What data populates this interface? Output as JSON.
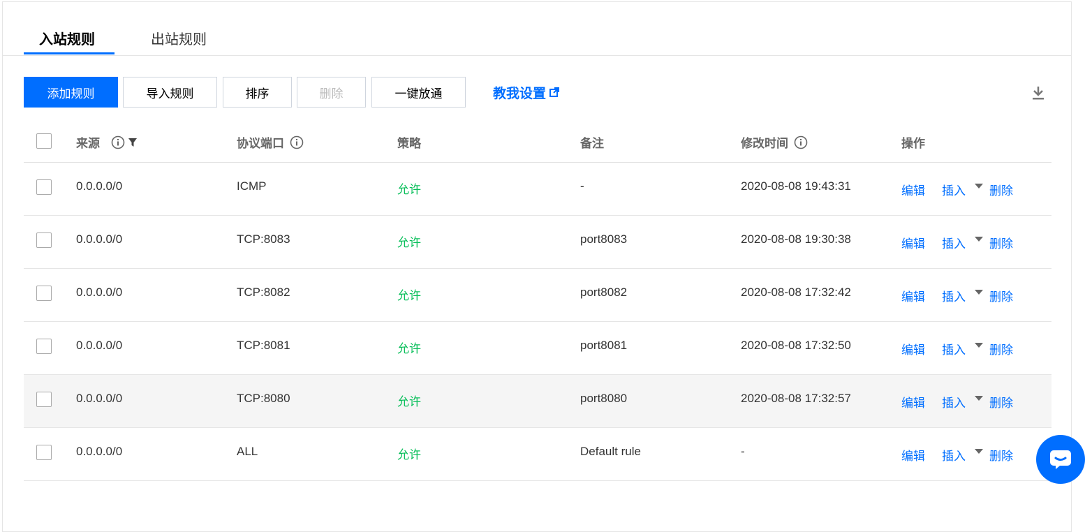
{
  "tabs": [
    {
      "label": "入站规则",
      "active": true
    },
    {
      "label": "出站规则",
      "active": false
    }
  ],
  "toolbar": {
    "add_label": "添加规则",
    "import_label": "导入规则",
    "sort_label": "排序",
    "delete_label": "删除",
    "open_all_label": "一键放通",
    "help_label": "教我设置"
  },
  "table": {
    "headers": {
      "source": "来源",
      "protocol_port": "协议端口",
      "policy": "策略",
      "remark": "备注",
      "modified_time": "修改时间",
      "actions": "操作"
    },
    "rows": [
      {
        "source": "0.0.0.0/0",
        "protocol_port": "ICMP",
        "policy": "允许",
        "remark": "-",
        "modified_time": "2020-08-08 19:43:31"
      },
      {
        "source": "0.0.0.0/0",
        "protocol_port": "TCP:8083",
        "policy": "允许",
        "remark": "port8083",
        "modified_time": "2020-08-08 19:30:38"
      },
      {
        "source": "0.0.0.0/0",
        "protocol_port": "TCP:8082",
        "policy": "允许",
        "remark": "port8082",
        "modified_time": "2020-08-08 17:32:42"
      },
      {
        "source": "0.0.0.0/0",
        "protocol_port": "TCP:8081",
        "policy": "允许",
        "remark": "port8081",
        "modified_time": "2020-08-08 17:32:50"
      },
      {
        "source": "0.0.0.0/0",
        "protocol_port": "TCP:8080",
        "policy": "允许",
        "remark": "port8080",
        "modified_time": "2020-08-08 17:32:57"
      },
      {
        "source": "0.0.0.0/0",
        "protocol_port": "ALL",
        "policy": "允许",
        "remark": "Default rule",
        "modified_time": "-"
      }
    ],
    "row_actions": {
      "edit": "编辑",
      "insert": "插入",
      "delete": "删除"
    }
  },
  "colors": {
    "accent": "#006eff",
    "allow": "#0abf5b",
    "hover_row": "#f5f5f5"
  },
  "icons": [
    "info-icon",
    "filter-icon",
    "external-link-icon",
    "download-icon",
    "chevron-down-icon",
    "chat-icon"
  ]
}
